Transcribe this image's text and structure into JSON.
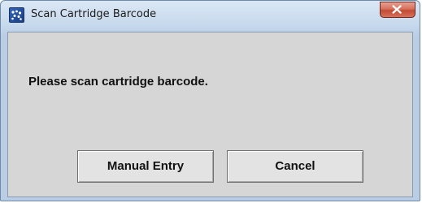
{
  "window": {
    "title": "Scan Cartridge Barcode",
    "icon": "app-dots-icon",
    "close_icon": "close-icon"
  },
  "dialog": {
    "message": "Please scan cartridge barcode.",
    "buttons": {
      "manual_entry": "Manual Entry",
      "cancel": "Cancel"
    }
  },
  "colors": {
    "title_bar": "#c7d9ed",
    "client_background": "#d6d6d6",
    "close_button": "#c14a33",
    "button_face": "#e3e3e3"
  }
}
